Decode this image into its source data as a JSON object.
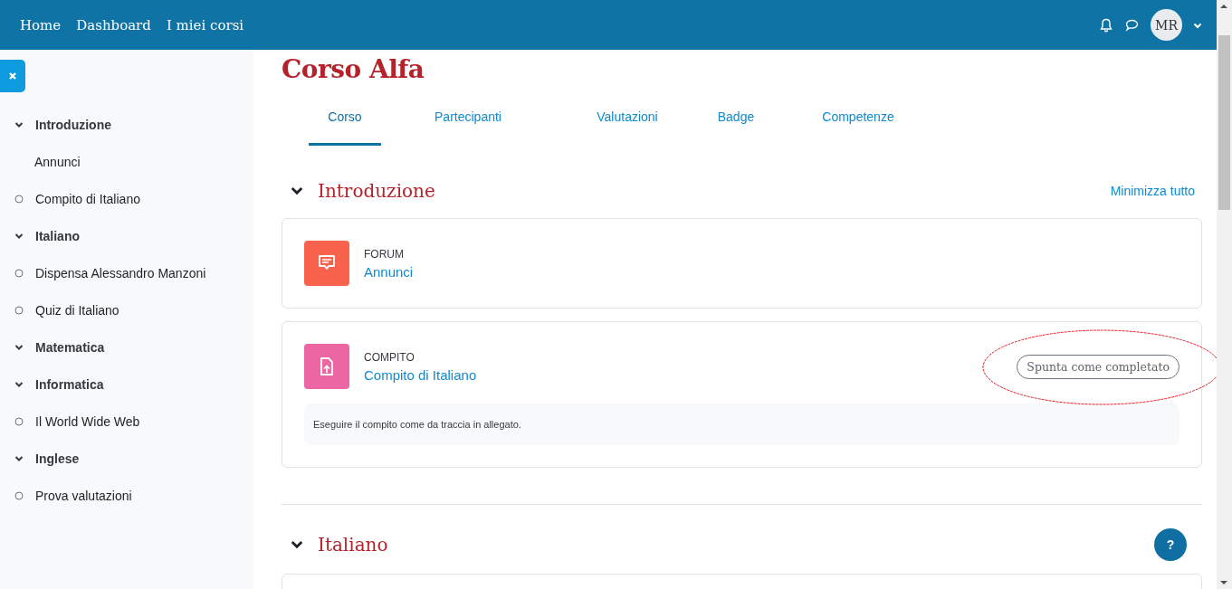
{
  "navbar": {
    "links": [
      "Home",
      "Dashboard",
      "I miei corsi"
    ],
    "avatar": "MR"
  },
  "sidebar": {
    "items": [
      {
        "kind": "section",
        "label": "Introduzione"
      },
      {
        "kind": "plain",
        "label": "Annunci"
      },
      {
        "kind": "activity",
        "label": "Compito di Italiano"
      },
      {
        "kind": "section",
        "label": "Italiano"
      },
      {
        "kind": "activity",
        "label": "Dispensa Alessandro Manzoni"
      },
      {
        "kind": "activity",
        "label": "Quiz di Italiano"
      },
      {
        "kind": "section",
        "label": "Matematica"
      },
      {
        "kind": "section",
        "label": "Informatica"
      },
      {
        "kind": "activity",
        "label": "Il World Wide Web"
      },
      {
        "kind": "section",
        "label": "Inglese"
      },
      {
        "kind": "activity",
        "label": "Prova valutazioni"
      }
    ]
  },
  "course": {
    "title": "Corso Alfa",
    "tabs": [
      {
        "label": "Corso",
        "selected": true
      },
      {
        "label": "Partecipanti",
        "selected": false
      },
      {
        "label": "Valutazioni",
        "selected": false
      },
      {
        "label": "Badge",
        "selected": false
      },
      {
        "label": "Competenze",
        "selected": false
      }
    ],
    "collapse_all": "Minimizza tutto",
    "sections": [
      {
        "title": "Introduzione",
        "activities": [
          {
            "kind": "forum",
            "color": "#f7634d",
            "type": "FORUM",
            "name": "Annunci"
          },
          {
            "kind": "assign",
            "color": "#eb66a2",
            "type": "COMPITO",
            "name": "Compito di Italiano",
            "completion": "Spunta come completato",
            "description": "Eseguire il compito come da traccia in allegato."
          }
        ]
      },
      {
        "title": "Italiano"
      }
    ]
  },
  "help_button": "?"
}
